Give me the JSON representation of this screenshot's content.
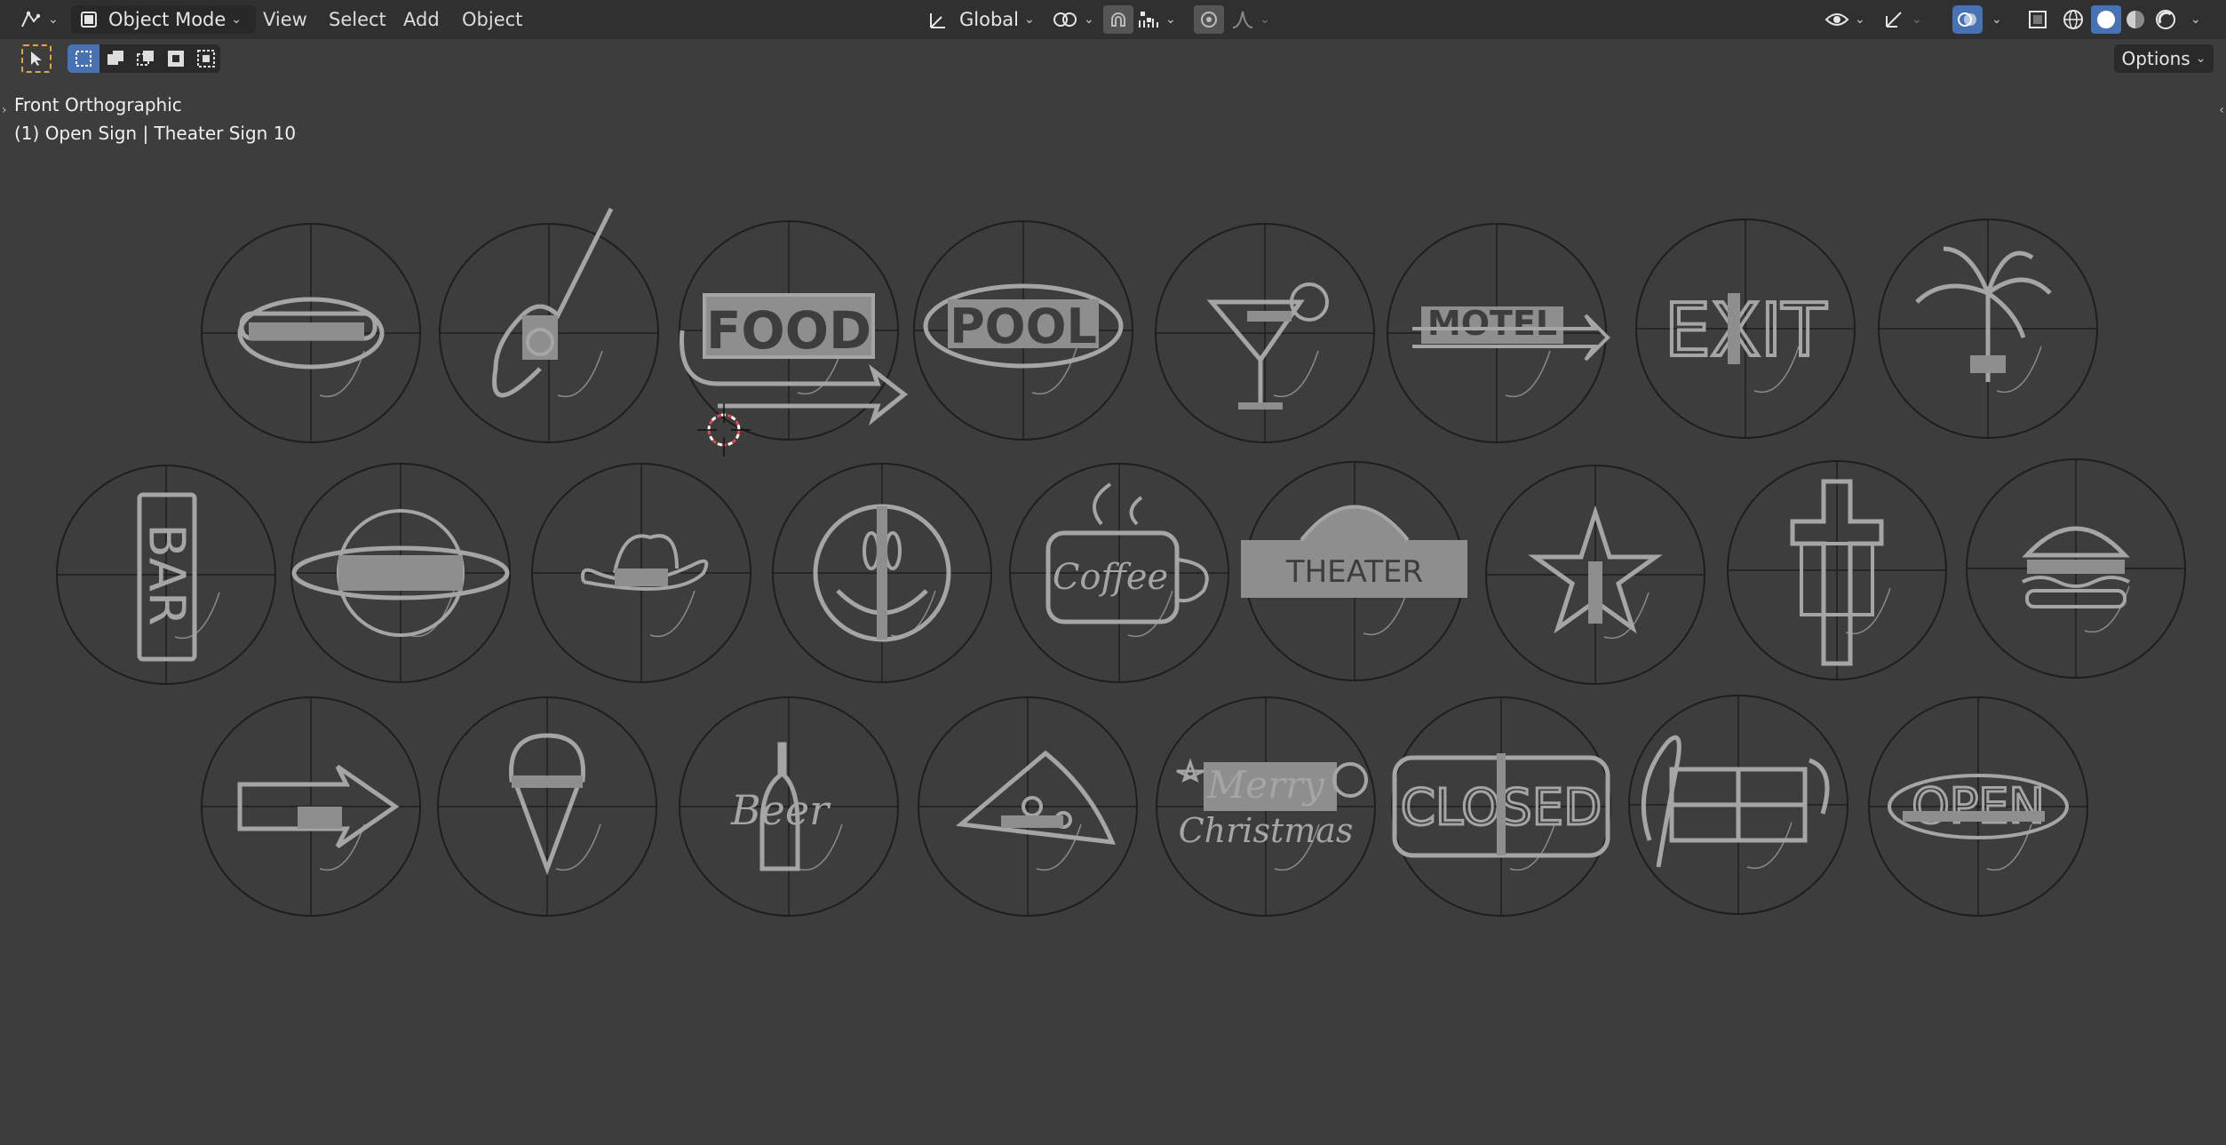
{
  "header": {
    "editor_icon": "editor-type-icon",
    "mode_label": "Object Mode",
    "menus": [
      "View",
      "Select",
      "Add",
      "Object"
    ],
    "transform_orientation": "Global",
    "options_label": "Options"
  },
  "viewport": {
    "view_name": "Front Orthographic",
    "object_info": "(1) Open Sign | Theater Sign 10"
  },
  "signs": {
    "row1": [
      "Hot Dog",
      "Guitar",
      "FOOD",
      "POOL",
      "Cocktail",
      "MOTEL",
      "EXIT",
      "Palm Tree"
    ],
    "row2": [
      "BAR",
      "Eye",
      "Cowboy Hat",
      "Smiley",
      "Coffee",
      "THEATER",
      "Star",
      "Cross",
      "Burger"
    ],
    "row3": [
      "Arrow",
      "Ice Cream",
      "Beer",
      "Pizza",
      "Merry Christmas",
      "CLOSED",
      "Music",
      "OPEN"
    ],
    "labels": {
      "food": "FOOD",
      "pool": "POOL",
      "motel": "MOTEL",
      "exit": "EXIT",
      "bar": "BAR",
      "coffee": "Coffee",
      "theater": "THEATER",
      "beer": "Beer",
      "merry": "Merry",
      "christmas": "Christmas",
      "closed": "CLOSED",
      "open": "OPEN"
    }
  },
  "colors": {
    "viewport_bg": "#3d3d3d",
    "header_bg": "#303030",
    "accent_blue": "#4772b3",
    "select_orange": "#e8a33b",
    "sign_fill": "#9a9a9a",
    "circle_stroke": "#1e1e1e"
  }
}
